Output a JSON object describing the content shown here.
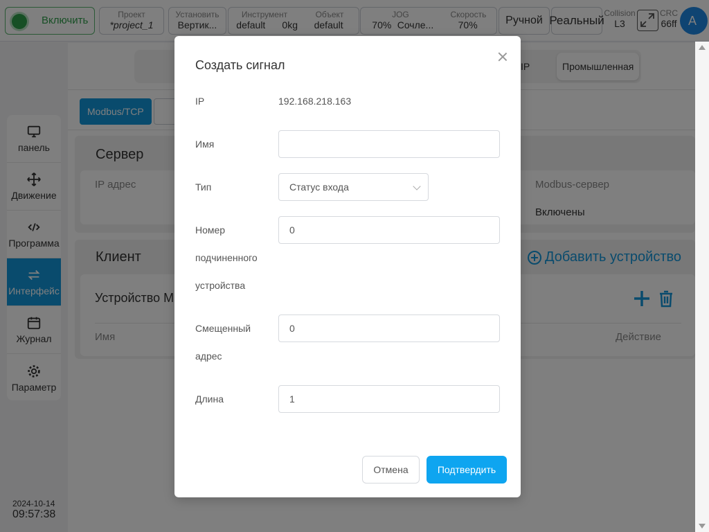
{
  "topbar": {
    "enable_label": "Включить",
    "project": {
      "caption": "Проект",
      "value": "*project_1"
    },
    "mount": {
      "caption": "Установить",
      "value": "Вертик..."
    },
    "tool": {
      "caption": "Инструмент",
      "value1": "default",
      "value2": "0kg"
    },
    "object": {
      "caption": "Объект",
      "value": "default"
    },
    "jog": {
      "caption": "JOG",
      "value1": "70%",
      "value2": "Сочле..."
    },
    "speed": {
      "caption": "Скорость",
      "value": "70%"
    },
    "mode": "Ручной",
    "real": "Реальный",
    "collision": {
      "caption": "Collision",
      "value": "L3"
    },
    "crc": {
      "caption": "CRC",
      "value": "66ff"
    },
    "avatar": "A"
  },
  "sidebar": {
    "items": [
      {
        "label": "панель",
        "icon": "monitor-icon"
      },
      {
        "label": "Движение",
        "icon": "move-icon"
      },
      {
        "label": "Программа",
        "icon": "code-icon"
      },
      {
        "label": "Интерфейс",
        "icon": "interface-icon",
        "active": true
      },
      {
        "label": "Журнал",
        "icon": "calendar-icon"
      },
      {
        "label": "Параметр",
        "icon": "gear-icon"
      }
    ],
    "date": "2024-10-14",
    "time": "09:57:38"
  },
  "main": {
    "protocol_tab_ip": "IP",
    "protocol_tab_industrial": "Промышленная",
    "sub_tab_active": "Modbus/TCP",
    "server": {
      "title": "Сервер",
      "ip_label": "IP адрес",
      "modbus_label": "Modbus-сервер",
      "modbus_value": "Включены"
    },
    "client": {
      "title": "Клиент",
      "add_device": "Добавить устройство",
      "device_title": "Устройство M",
      "col_name": "Имя",
      "col_action": "Действие"
    }
  },
  "modal": {
    "title": "Создать сигнал",
    "ip_label": "IP",
    "ip_value": "192.168.218.163",
    "name_label": "Имя",
    "name_value": "",
    "type_label": "Тип",
    "type_value": "Статус входа",
    "slave_label_1": "Номер",
    "slave_label_2": "подчиненного",
    "slave_label_3": "устройства",
    "slave_value": "0",
    "offset_label_1": "Смещенный",
    "offset_label_2": "адрес",
    "offset_value": "0",
    "length_label": "Длина",
    "length_value": "1",
    "cancel": "Отмена",
    "confirm": "Подтвердить"
  },
  "colors": {
    "accent": "#1296db",
    "confirm": "#0ea5f0",
    "enable_green": "#2e9e4a"
  }
}
